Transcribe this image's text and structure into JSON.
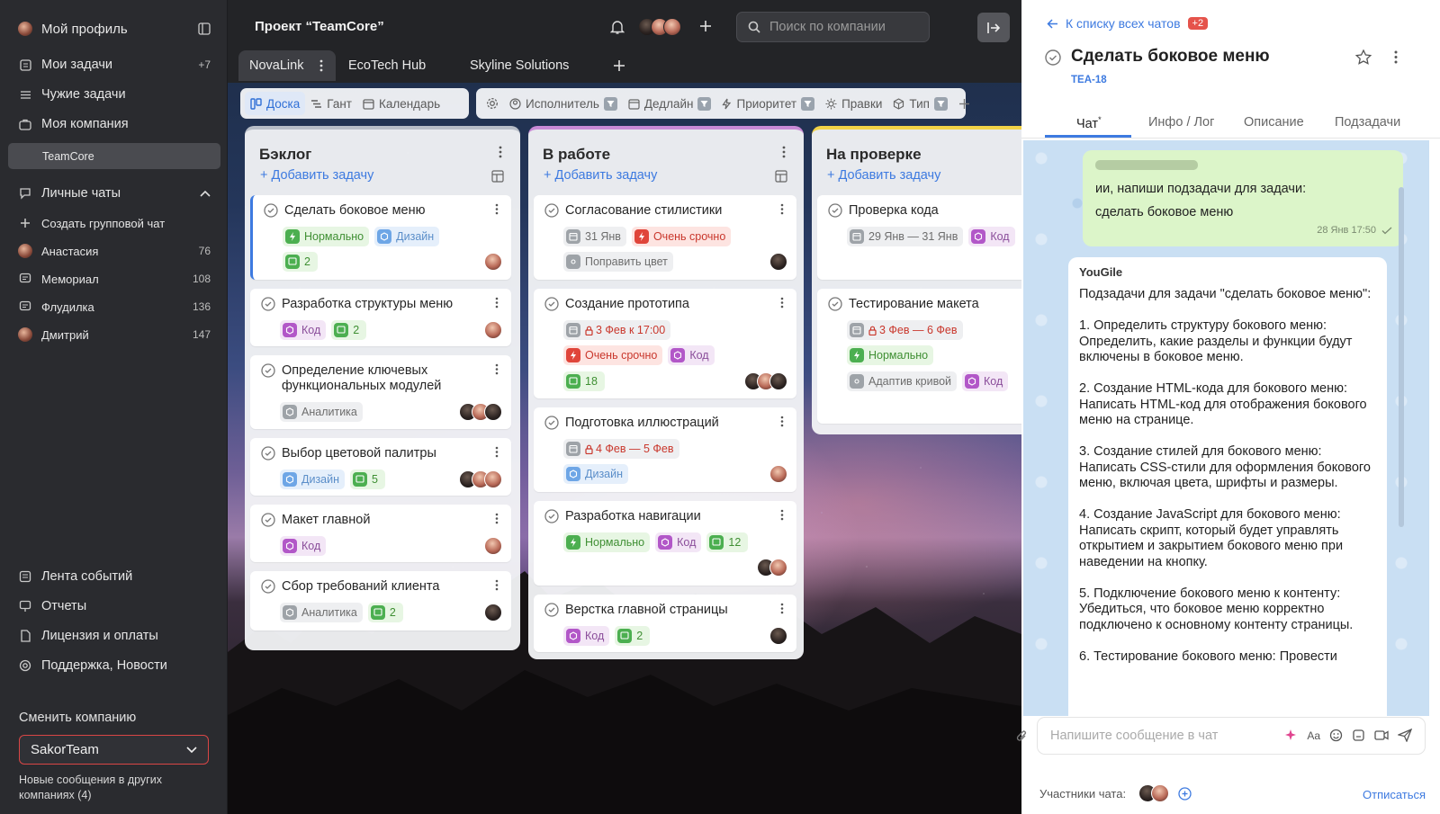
{
  "sidebar": {
    "profile": "Мой профиль",
    "items": [
      {
        "label": "Мои задачи",
        "count": "+7"
      },
      {
        "label": "Чужие задачи"
      },
      {
        "label": "Моя компания"
      }
    ],
    "company_item": "TeamCore",
    "personal_chats": "Личные чаты",
    "create_group": "Создать групповой чат",
    "chats": [
      {
        "label": "Анастасия",
        "count": "76"
      },
      {
        "label": "Мемориал",
        "count": "108"
      },
      {
        "label": "Флудилка",
        "count": "136"
      },
      {
        "label": "Дмитрий",
        "count": "147"
      }
    ],
    "bottom": [
      "Лента событий",
      "Отчеты",
      "Лицензия и оплаты",
      "Поддержка, Новости"
    ],
    "switch_company": "Сменить компанию",
    "company_value": "SakorTeam",
    "new_messages": "Новые сообщения в других компаниях (4)"
  },
  "topbar": {
    "project": "Проект “TeamCore”",
    "search_placeholder": "Поиск по компании"
  },
  "project_tabs": [
    "NovaLink",
    "EcoTech Hub",
    "Skyline Solutions"
  ],
  "views": [
    "Доска",
    "Гант",
    "Календарь"
  ],
  "filters": [
    "Исполнитель",
    "Дедлайн",
    "Приоритет",
    "Правки",
    "Тип"
  ],
  "columns": [
    {
      "title": "Бэклог",
      "add": "+ Добавить задачу",
      "color": "#b7bdc6"
    },
    {
      "title": "В работе",
      "add": "+ Добавить задачу",
      "color": "#c98ad6"
    },
    {
      "title": "На проверке",
      "add": "+ Добавить задачу",
      "color": "#f1d247"
    }
  ],
  "cards": {
    "c1": {
      "title": "Сделать боковое меню",
      "tags": [
        "Нормально",
        "Дизайн"
      ],
      "comments": "2"
    },
    "c2": {
      "title": "Разработка структуры меню",
      "tags": [
        "Код"
      ],
      "comments": "2"
    },
    "c3": {
      "title": "Определение ключевых функциональных модулей",
      "tags": [
        "Аналитика"
      ]
    },
    "c4": {
      "title": "Выбор цветовой палитры",
      "tags": [
        "Дизайн"
      ],
      "comments": "5"
    },
    "c5": {
      "title": "Макет главной",
      "tags": [
        "Код"
      ]
    },
    "c6": {
      "title": "Сбор требований клиента",
      "tags": [
        "Аналитика"
      ],
      "comments": "2"
    },
    "w1": {
      "title": "Согласование стилистики",
      "date": "31 Янв",
      "tags": [
        "Очень срочно",
        "Поправить цвет"
      ]
    },
    "w2": {
      "title": "Создание прототипа",
      "date": "3 Фев к 17:00",
      "tags": [
        "Очень срочно",
        "Код"
      ],
      "comments": "18"
    },
    "w3": {
      "title": "Подготовка иллюстраций",
      "date": "4 Фев — 5 Фев",
      "tags": [
        "Дизайн"
      ]
    },
    "w4": {
      "title": "Разработка навигации",
      "tags": [
        "Нормально",
        "Код"
      ],
      "comments": "12"
    },
    "w5": {
      "title": "Верстка главной страницы",
      "tags": [
        "Код"
      ],
      "comments": "2"
    },
    "r1": {
      "title": "Проверка кода",
      "date": "29 Янв — 31 Янв",
      "tags": [
        "Код"
      ]
    },
    "r2": {
      "title": "Тестирование макета",
      "date": "3 Фев — 6 Фев",
      "tags": [
        "Нормально",
        "Адаптив кривой",
        "Код"
      ]
    }
  },
  "panel": {
    "back": "К списку всех чатов",
    "badge": "+2",
    "title": "Сделать боковое меню",
    "code": "TEA-18",
    "tabs": [
      "Чат",
      "Инфо / Лог",
      "Описание",
      "Подзадачи"
    ],
    "out_msg": {
      "line1": "ии, напиши подзадачи для задачи:",
      "line2": "сделать боковое меню",
      "time": "28 Янв 17:50"
    },
    "in_msg": {
      "author": "YouGile",
      "text": "Подзадачи для задачи \"сделать боковое меню\":\n\n1. Определить структуру бокового меню: Определить, какие разделы и функции будут включены в боковое меню.\n\n2. Создание HTML-кода для бокового меню: Написать HTML-код для отображения бокового меню на странице.\n\n3. Создание стилей для бокового меню: Написать CSS-стили для оформления бокового меню, включая цвета, шрифты и размеры.\n\n4. Создание JavaScript для бокового меню: Написать скрипт, который будет управлять открытием и закрытием бокового меню при наведении на кнопку.\n\n5. Подключение бокового меню к контенту: Убедиться, что боковое меню корректно подключено к основному контенту страницы.\n\n6. Тестирование бокового меню: Провести"
    },
    "composer_placeholder": "Напишите сообщение в чат",
    "members": "Участники чата:",
    "unsubscribe": "Отписаться"
  }
}
